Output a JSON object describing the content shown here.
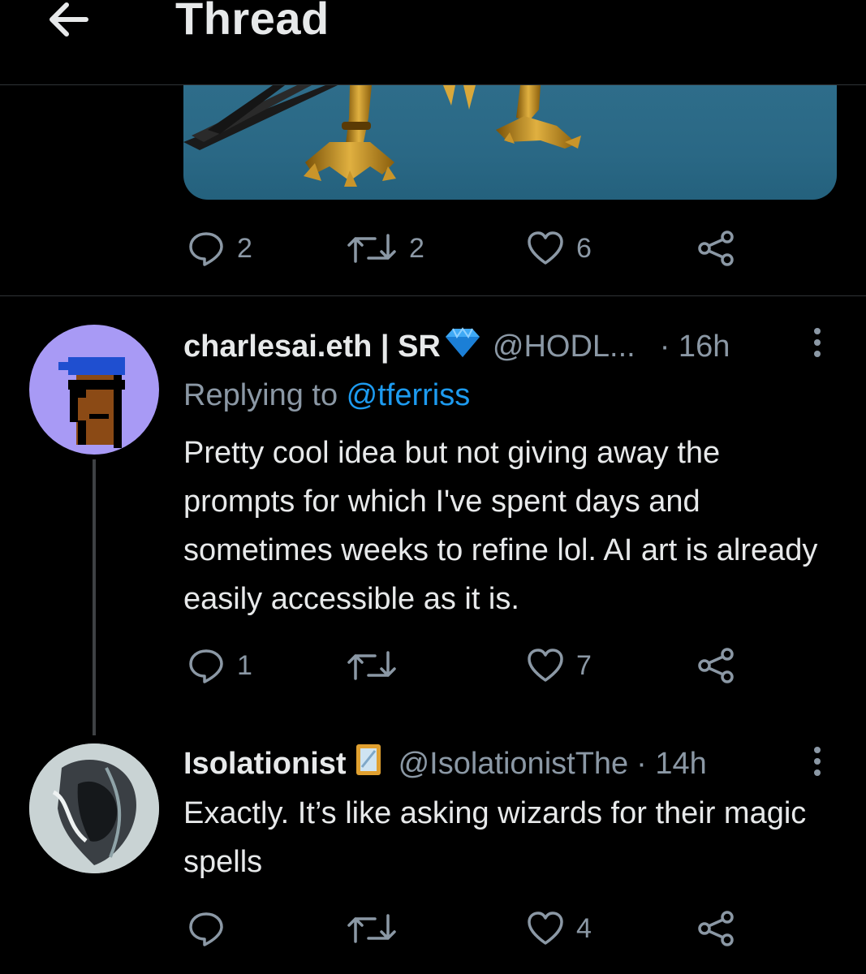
{
  "header": {
    "title": "Thread",
    "back_icon": "arrow-left-icon"
  },
  "top_tweet": {
    "actions": {
      "reply_count": "2",
      "retweet_count": "2",
      "like_count": "6"
    }
  },
  "reply1": {
    "display_name": "charlesai.eth | SR",
    "badge_icon": "diamond-icon",
    "handle": "@HODL...",
    "time": "· 16h",
    "replying_prefix": "Replying to ",
    "replying_handle": "@tferriss",
    "text": "Pretty cool idea but not giving away the prompts for which I've spent days and sometimes weeks to refine lol. AI art is already easily accessible as it is.",
    "actions": {
      "reply_count": "1",
      "retweet_count": "",
      "like_count": "7"
    }
  },
  "reply2": {
    "display_name": "Isolationist",
    "badge_icon": "mirror-frame-icon",
    "handle": "@IsolationistThe",
    "time": "· 14h",
    "text": "Exactly. It’s like asking wizards for their magic spells",
    "actions": {
      "reply_count": "",
      "retweet_count": "",
      "like_count": "4"
    }
  },
  "colors": {
    "background": "#000000",
    "text": "#e7e9ea",
    "muted": "#8b98a5",
    "link": "#1d9bf0",
    "divider": "#2f3336"
  }
}
